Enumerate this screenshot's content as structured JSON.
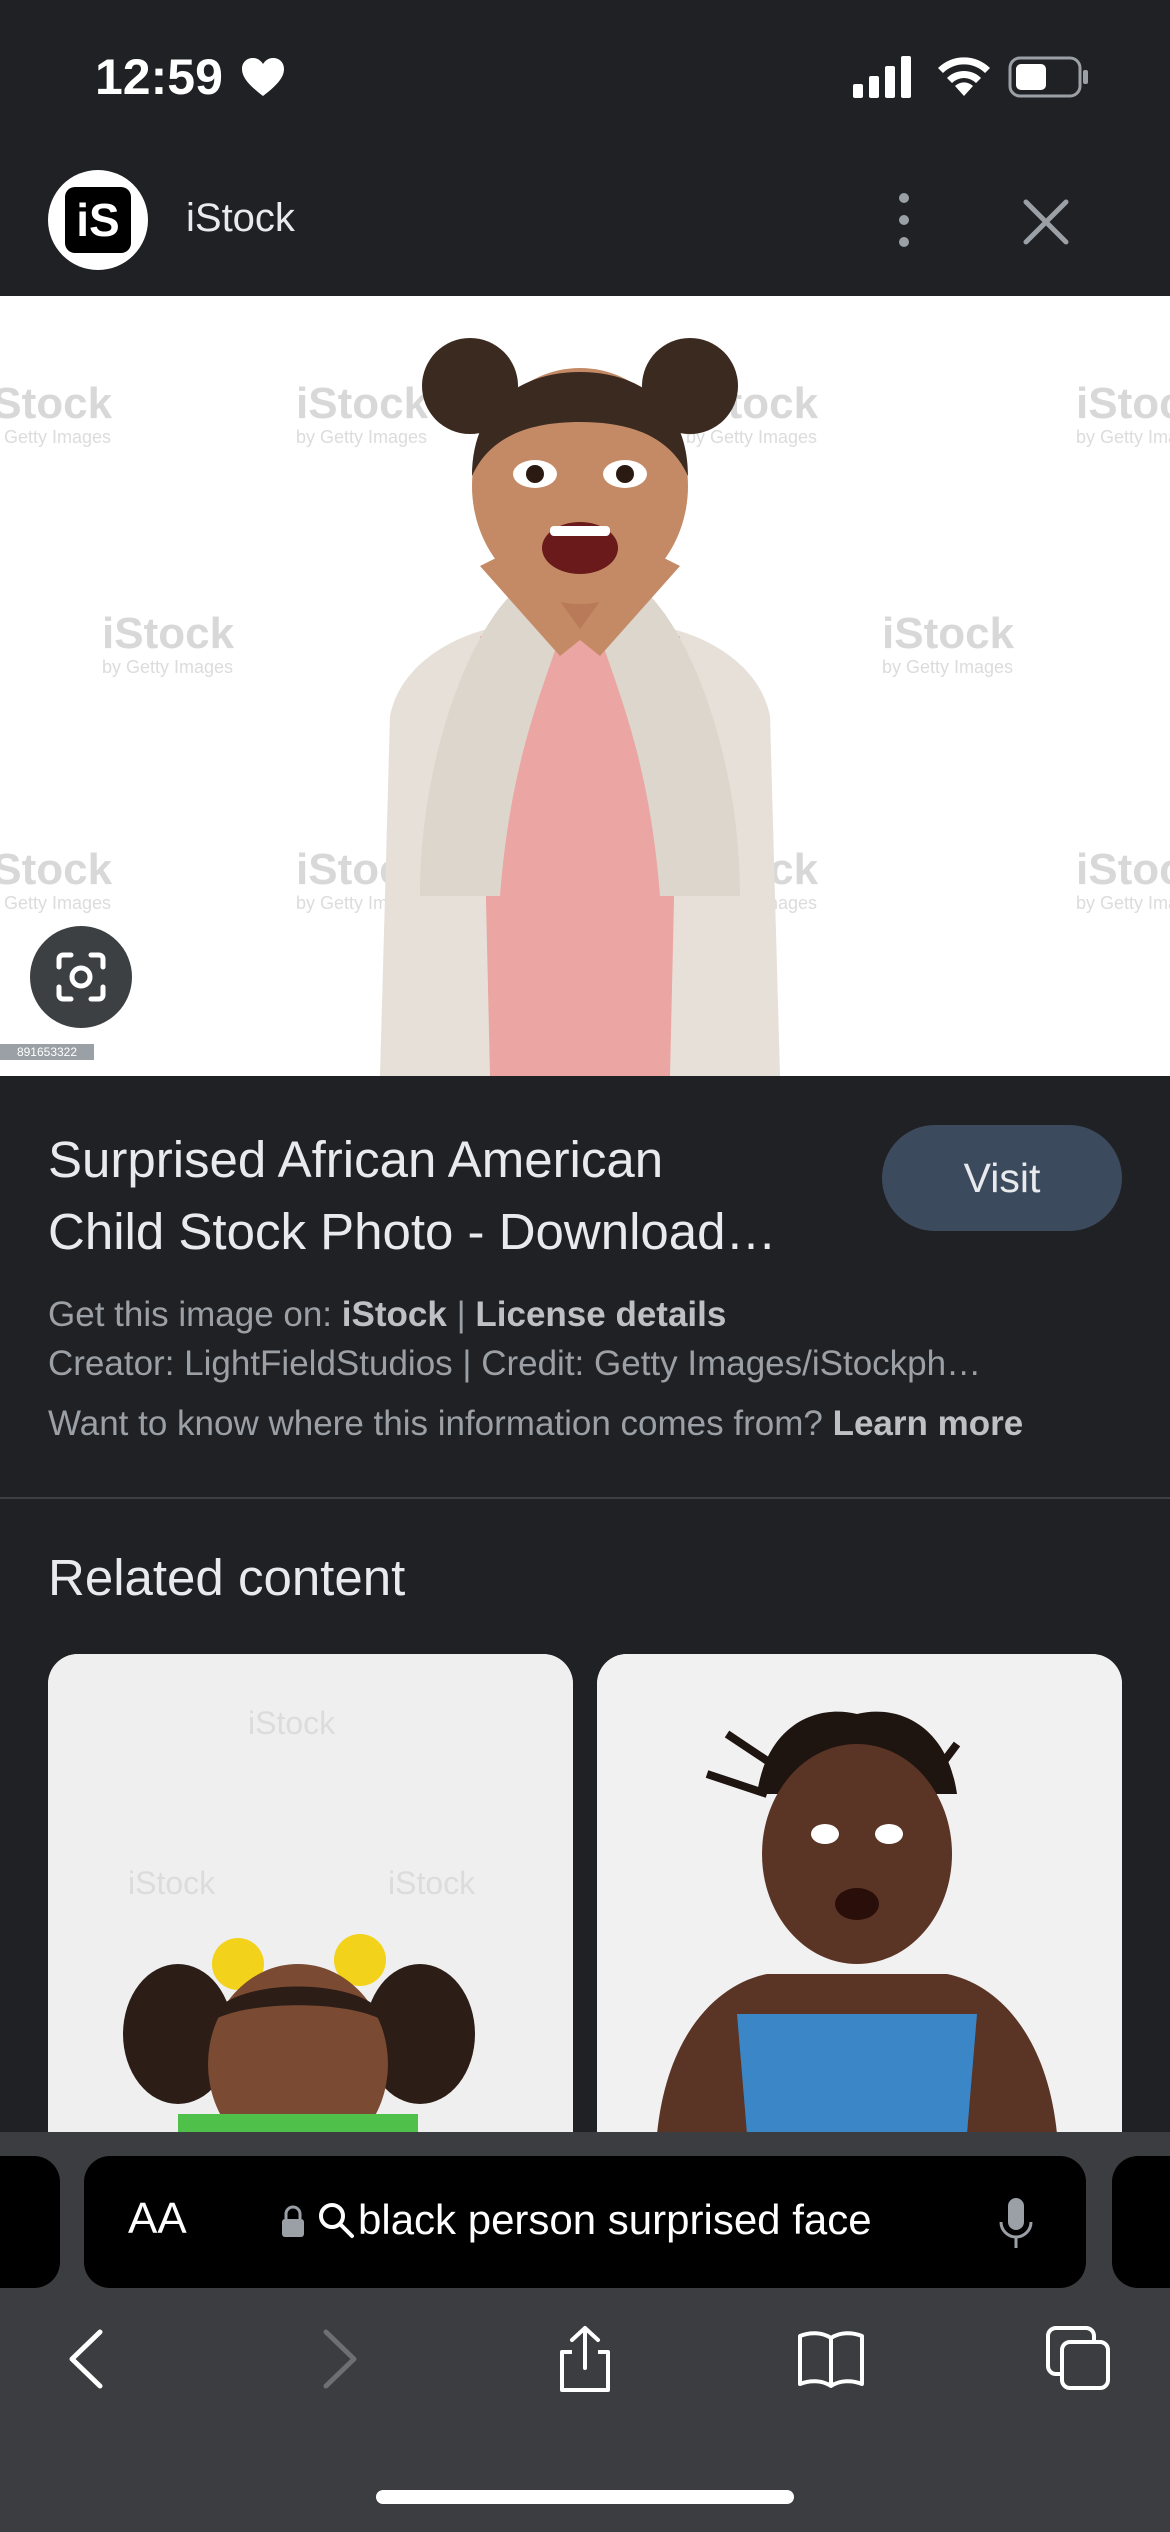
{
  "status_bar": {
    "time": "12:59"
  },
  "header": {
    "site_name": "iStock",
    "logo_text": "iS"
  },
  "image": {
    "watermark_text": "iStock",
    "watermark_sub": "by Getty Images",
    "image_id": "891653322"
  },
  "result": {
    "title_line1": "Surprised African American",
    "title_line2": "Child Stock Photo - Download…",
    "visit_label": "Visit",
    "get_image_prefix": "Get this image on:",
    "source_name": "iStock",
    "separator": "|",
    "license_label": "License details",
    "creator_line": "Creator: LightFieldStudios | Credit: Getty Images/iStockph…",
    "info_question": "Want to know where this information comes from?",
    "learn_more": "Learn more"
  },
  "related": {
    "title": "Related content"
  },
  "address_bar": {
    "text_size_label": "AA",
    "query": "black person surprised face"
  },
  "colors": {
    "background": "#202124",
    "visit_button": "#3c4a5e",
    "toolbar": "#3c3d40"
  }
}
